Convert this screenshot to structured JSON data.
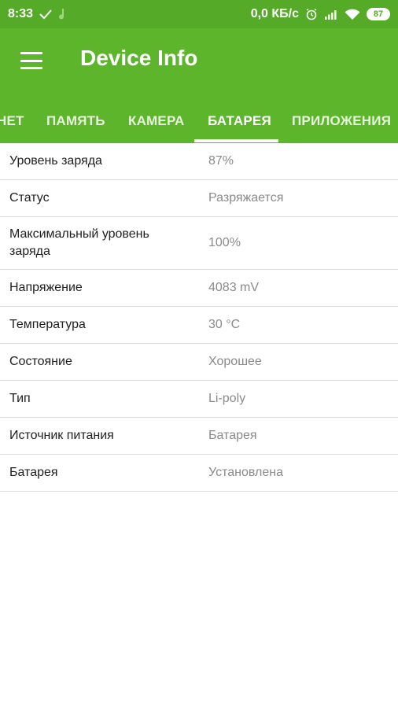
{
  "status_bar": {
    "time": "8:33",
    "network_speed": "0,0 КБ/с",
    "battery_level": "87",
    "icons": [
      "check-icon",
      "music-note-icon",
      "alarm-icon",
      "signal-icon",
      "wifi-icon",
      "battery-icon"
    ]
  },
  "app_bar": {
    "title": "Device Info",
    "menu_icon": "hamburger-menu-icon",
    "background_color": "#5cb52b"
  },
  "tabs": [
    {
      "label": "НЕТ"
    },
    {
      "label": "ПАМЯТЬ"
    },
    {
      "label": "КАМЕРА"
    },
    {
      "label": "БАТАРЕЯ"
    },
    {
      "label": "ПРИЛОЖЕНИЯ"
    }
  ],
  "active_tab": "БАТАРЕЯ",
  "rows": [
    {
      "label": "Уровень заряда",
      "value": "87%"
    },
    {
      "label": "Статус",
      "value": "Разряжается"
    },
    {
      "label": "Максимальный уровень заряда",
      "value": "100%"
    },
    {
      "label": "Напряжение",
      "value": "4083 mV"
    },
    {
      "label": "Температура",
      "value": "30 °C"
    },
    {
      "label": "Состояние",
      "value": "Хорошее"
    },
    {
      "label": "Тип",
      "value": "Li-poly"
    },
    {
      "label": "Источник питания",
      "value": "Батарея"
    },
    {
      "label": "Батарея",
      "value": "Установлена"
    }
  ]
}
